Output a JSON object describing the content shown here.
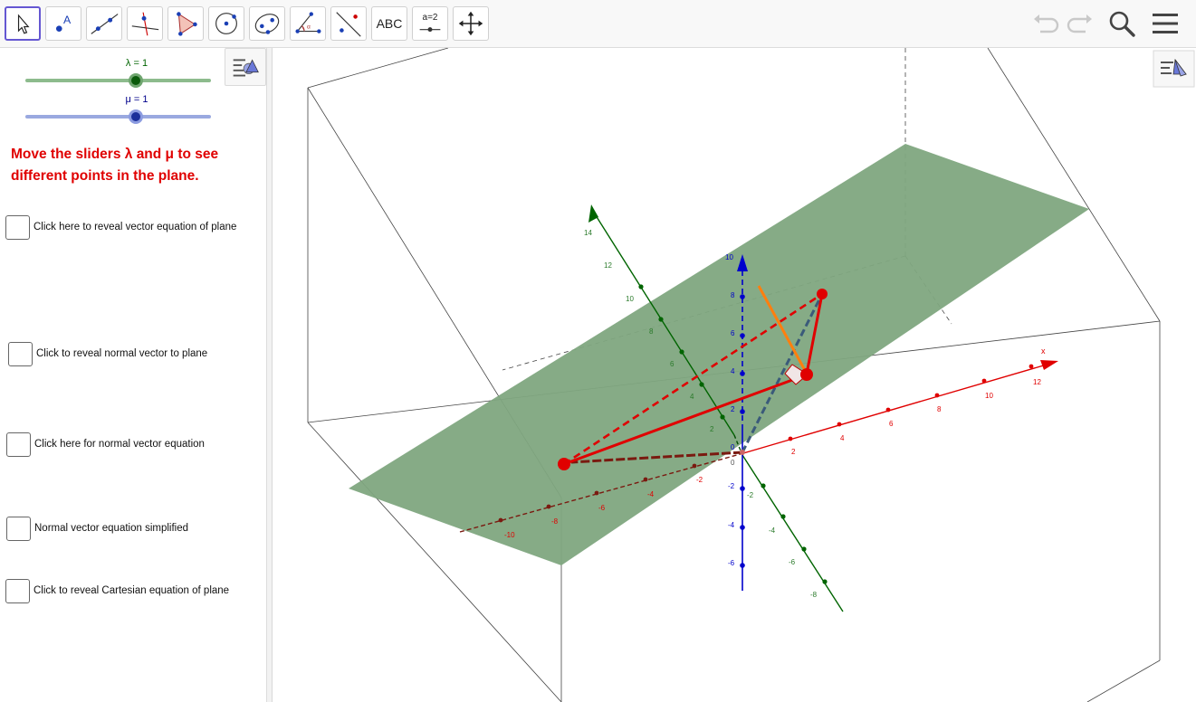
{
  "toolbar": {
    "tools": [
      {
        "name": "move-tool",
        "label": ""
      },
      {
        "name": "point-tool",
        "label": ""
      },
      {
        "name": "line-tool",
        "label": ""
      },
      {
        "name": "perpendicular-line-tool",
        "label": ""
      },
      {
        "name": "polygon-tool",
        "label": ""
      },
      {
        "name": "circle-tool",
        "label": ""
      },
      {
        "name": "conic-tool",
        "label": ""
      },
      {
        "name": "angle-tool",
        "label": ""
      },
      {
        "name": "reflect-tool",
        "label": ""
      },
      {
        "name": "text-tool",
        "label": "ABC"
      },
      {
        "name": "slider-tool",
        "label": "a=2"
      },
      {
        "name": "move-graphics-tool",
        "label": ""
      }
    ],
    "icons": [
      "undo-icon",
      "redo-icon",
      "search-icon",
      "menu-icon"
    ]
  },
  "sliders": [
    {
      "label": "λ = 1",
      "value": 1,
      "color": "#006400",
      "track_color": "#8dbb8d"
    },
    {
      "label": "μ = 1",
      "value": 1,
      "color": "#00008b",
      "track_color": "#9aa9e0"
    }
  ],
  "instructions": "Move the sliders λ and μ to see different points in the plane.",
  "checkboxes": [
    {
      "label": "Click here to reveal vector equation of plane",
      "checked": false
    },
    {
      "label": "Click to reveal normal vector to plane",
      "checked": false
    },
    {
      "label": "Click here for normal vector equation",
      "checked": false
    },
    {
      "label": "Normal vector equation simplified",
      "checked": false
    },
    {
      "label": "Click to reveal Cartesian equation of plane",
      "checked": false
    }
  ],
  "graphics3d": {
    "x_axis_label": "x",
    "x_ticks": [
      "-10",
      "-8",
      "-6",
      "-4",
      "-2",
      "2",
      "4",
      "6",
      "8",
      "10",
      "12"
    ],
    "y_ticks": [
      "-8",
      "-6",
      "-4",
      "-2",
      "2",
      "4",
      "6",
      "8",
      "10",
      "12",
      "14"
    ],
    "z_ticks": [
      "-6",
      "-4",
      "-2",
      "0",
      "2",
      "4",
      "6",
      "8",
      "10"
    ],
    "origin_label": "0",
    "plane_color": "#7fa67f",
    "x_axis_color": "#e00000",
    "y_axis_color": "#006400",
    "z_axis_color": "#0000cc"
  }
}
